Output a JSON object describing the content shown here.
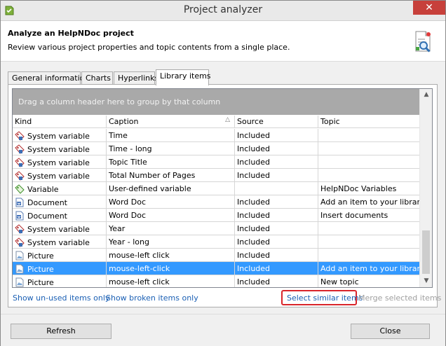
{
  "window": {
    "title": "Project analyzer",
    "close_glyph": "✕"
  },
  "header": {
    "title": "Analyze an HelpNDoc project",
    "subtitle": "Review various project properties and topic contents from a single place."
  },
  "tabs": [
    {
      "label": "General information",
      "active": false
    },
    {
      "label": "Charts",
      "active": false
    },
    {
      "label": "Hyperlinks",
      "active": false
    },
    {
      "label": "Library items",
      "active": true
    }
  ],
  "grid": {
    "group_hint": "Drag a column header here to group by that column",
    "columns": [
      "Kind",
      "Caption",
      "Source",
      "Topic"
    ],
    "sort_glyph": "△",
    "rows": [
      {
        "kind": "System variable",
        "icon": "system-variable-icon",
        "caption": "Time",
        "source": "Included",
        "topic": "",
        "selected": false
      },
      {
        "kind": "System variable",
        "icon": "system-variable-icon",
        "caption": "Time - long",
        "source": "Included",
        "topic": "",
        "selected": false
      },
      {
        "kind": "System variable",
        "icon": "system-variable-icon",
        "caption": "Topic Title",
        "source": "Included",
        "topic": "",
        "selected": false
      },
      {
        "kind": "System variable",
        "icon": "system-variable-icon",
        "caption": "Total Number of Pages",
        "source": "Included",
        "topic": "",
        "selected": false
      },
      {
        "kind": "Variable",
        "icon": "variable-icon",
        "caption": "User-defined variable",
        "source": "",
        "topic": "HelpNDoc Variables",
        "selected": false
      },
      {
        "kind": "Document",
        "icon": "document-icon",
        "caption": "Word Doc",
        "source": "Included",
        "topic": "Add an item to your library",
        "selected": false
      },
      {
        "kind": "Document",
        "icon": "document-icon",
        "caption": "Word Doc",
        "source": "Included",
        "topic": "Insert documents",
        "selected": false
      },
      {
        "kind": "System variable",
        "icon": "system-variable-icon",
        "caption": "Year",
        "source": "Included",
        "topic": "",
        "selected": false
      },
      {
        "kind": "System variable",
        "icon": "system-variable-icon",
        "caption": "Year - long",
        "source": "Included",
        "topic": "",
        "selected": false
      },
      {
        "kind": "Picture",
        "icon": "picture-icon",
        "caption": "mouse-left click",
        "source": "Included",
        "topic": "",
        "selected": false
      },
      {
        "kind": "Picture",
        "icon": "picture-icon",
        "caption": "mouse-left-click",
        "source": "Included",
        "topic": "Add an item to your library",
        "selected": true
      },
      {
        "kind": "Picture",
        "icon": "picture-icon",
        "caption": "mouse-left click",
        "source": "Included",
        "topic": "New topic",
        "selected": false
      }
    ],
    "scroll_up_glyph": "▲",
    "scroll_down_glyph": "▼"
  },
  "links": {
    "show_unused": "Show un-used items only",
    "show_broken": "Show broken items only",
    "select_similar": "Select similar items",
    "merge_selected": "Merge selected items"
  },
  "buttons": {
    "refresh": "Refresh",
    "close": "Close"
  },
  "colors": {
    "selection": "#3399ff",
    "group_bar": "#a9a9a9",
    "link": "#1a5fb4",
    "highlight": "#d9252b"
  }
}
